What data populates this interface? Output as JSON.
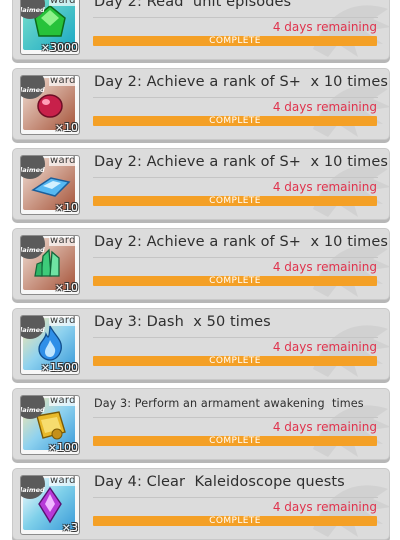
{
  "missions": [
    {
      "title": "Day 2: Read  unit episodes",
      "remaining": "4 days remaining",
      "status": "COMPLETE",
      "reward_label": "ward",
      "claimed_label": "Claimed",
      "quantity": "×3000",
      "icon": "green-gem-icon",
      "icon_bg": "#39b9c9"
    },
    {
      "title": "Day 2: Achieve a rank of S+  x 10 times",
      "remaining": "4 days remaining",
      "status": "COMPLETE",
      "reward_label": "ward",
      "claimed_label": "Claimed",
      "quantity": "×10",
      "icon": "red-crystal-icon",
      "icon_bg": "#b0603a"
    },
    {
      "title": "Day 2: Achieve a rank of S+  x 10 times",
      "remaining": "4 days remaining",
      "status": "COMPLETE",
      "reward_label": "ward",
      "claimed_label": "Claimed",
      "quantity": "×10",
      "icon": "blue-crystal-icon",
      "icon_bg": "#b0603a"
    },
    {
      "title": "Day 2: Achieve a rank of S+  x 10 times",
      "remaining": "4 days remaining",
      "status": "COMPLETE",
      "reward_label": "ward",
      "claimed_label": "Claimed",
      "quantity": "×10",
      "icon": "green-crystal-icon",
      "icon_bg": "#b0603a"
    },
    {
      "title": "Day 3: Dash  x 50 times",
      "remaining": "4 days remaining",
      "status": "COMPLETE",
      "reward_label": "ward",
      "claimed_label": "Claimed",
      "quantity": "×1500",
      "icon": "blue-flame-icon",
      "icon_bg": "#5ab0e0"
    },
    {
      "title": "Day 3: Perform an armament awakening  times",
      "remaining": "4 days remaining",
      "status": "COMPLETE",
      "reward_label": "ward",
      "claimed_label": "Claimed",
      "quantity": "×100",
      "icon": "gold-scroll-icon",
      "icon_bg": "#5ab0e0"
    },
    {
      "title": "Day 4: Clear  Kaleidoscope quests",
      "remaining": "4 days remaining",
      "status": "COMPLETE",
      "reward_label": "ward",
      "claimed_label": "Claimed",
      "quantity": "×3",
      "icon": "purple-gem-icon",
      "icon_bg": "#4fb0d8"
    }
  ],
  "colors": {
    "progress": "#f4a026",
    "remaining_text": "#e0334d",
    "card": "#dcdcdc"
  }
}
